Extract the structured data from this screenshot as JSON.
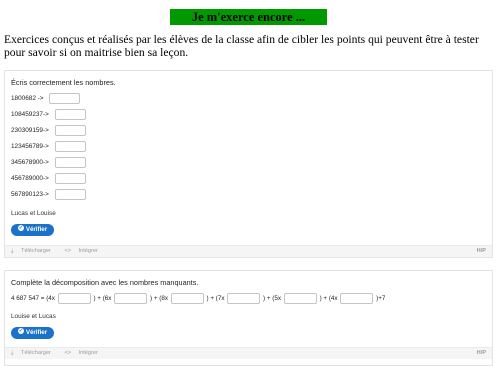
{
  "banner": "Je m'exerce encore ...",
  "intro": "Exercices conçus et réalisés par les élèves de la classe afin de cibler les points qui peuvent être à tester pour savoir si on maitrise bien sa leçon.",
  "exercise1": {
    "title": "Écris correctement les nombres.",
    "rows": [
      {
        "label": "1800682 ->",
        "value": ""
      },
      {
        "label": "108459237->",
        "value": ""
      },
      {
        "label": "230309159->",
        "value": ""
      },
      {
        "label": "123456789->",
        "value": ""
      },
      {
        "label": "345678900->",
        "value": ""
      },
      {
        "label": "456789000->",
        "value": ""
      },
      {
        "label": "567890123->",
        "value": ""
      }
    ],
    "authors": "Lucas et Louise",
    "verify_label": "Vérifier",
    "footer": {
      "download": "Télécharger",
      "embed": "Intégrer",
      "badge": "H/P"
    }
  },
  "exercise2": {
    "title": "Complète la décomposition avec les nombres manquants.",
    "equation": {
      "start": "4 687 547 = (4x",
      "parts": [
        ") + (6x",
        ") + (8x",
        ") + (7x",
        ") + (5x",
        ") + (4x",
        ")+7"
      ]
    },
    "authors": "Louise et Lucas",
    "verify_label": "Vérifier",
    "footer": {
      "download": "Télécharger",
      "embed": "Intégrer",
      "badge": "H/P"
    }
  }
}
